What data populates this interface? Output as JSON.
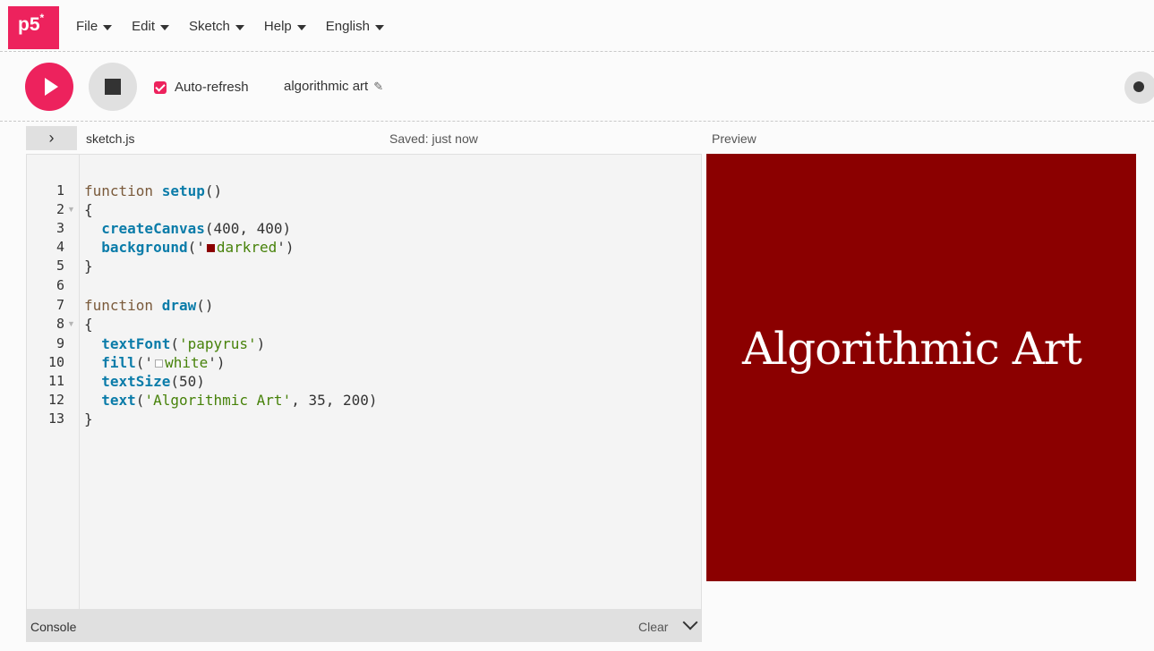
{
  "app": {
    "logo_text": "p5",
    "logo_sup": "*",
    "brand_color": "#ed225d"
  },
  "menu": {
    "items": [
      {
        "label": "File"
      },
      {
        "label": "Edit"
      },
      {
        "label": "Sketch"
      },
      {
        "label": "Help"
      },
      {
        "label": "English"
      }
    ]
  },
  "toolbar": {
    "auto_refresh_label": "Auto-refresh",
    "auto_refresh_checked": true,
    "sketch_name": "algorithmic art"
  },
  "editor": {
    "collapse_glyph": "›",
    "file_name": "sketch.js",
    "saved_status": "Saved: just now",
    "line_numbers": [
      "1",
      "2",
      "3",
      "4",
      "5",
      "6",
      "7",
      "8",
      "9",
      "10",
      "11",
      "12",
      "13"
    ],
    "folded_lines": [
      "2",
      "8"
    ],
    "code": {
      "l1_kw": "function ",
      "l1_fn": "setup",
      "l1_rest": "()",
      "l2": "{",
      "l3_fn": "createCanvas",
      "l3_rest": "(400, 400)",
      "l4_fn": "background",
      "l4_open": "('",
      "l4_str": "darkred",
      "l4_close": "')",
      "l5": "}",
      "l7_kw": "function ",
      "l7_fn": "draw",
      "l7_rest": "()",
      "l8": "{",
      "l9_fn": "textFont",
      "l9_open": "(",
      "l9_str": "'papyrus'",
      "l9_close": ")",
      "l10_fn": "fill",
      "l10_open": "('",
      "l10_str": "white",
      "l10_close": "')",
      "l11_fn": "textSize",
      "l11_rest": "(50)",
      "l12_fn": "text",
      "l12_open": "(",
      "l12_str": "'Algorithmic Art'",
      "l12_rest": ", 35, 200)",
      "l13": "}"
    },
    "swatch_colors": {
      "darkred": "#8b0000",
      "white": "#ffffff"
    }
  },
  "preview": {
    "label": "Preview",
    "canvas_bg": "#8b0000",
    "canvas_text": "Algorithmic Art"
  },
  "console": {
    "label": "Console",
    "clear_label": "Clear"
  }
}
